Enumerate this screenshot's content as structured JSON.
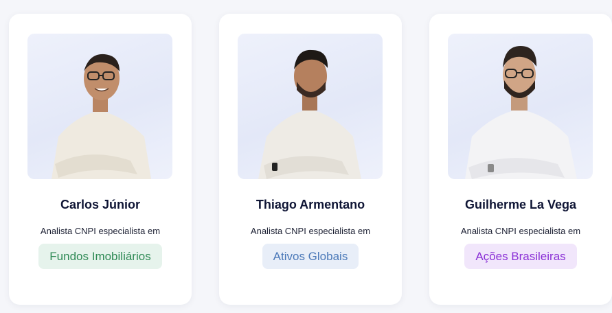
{
  "cards": [
    {
      "name": "Carlos Júnior",
      "role": "Analista CNPI especialista em",
      "tag": "Fundos Imobiliários",
      "tag_bg": "#e6f3ec",
      "tag_color": "#2f8a55"
    },
    {
      "name": "Thiago Armentano",
      "role": "Analista CNPI especialista em",
      "tag": "Ativos Globais",
      "tag_bg": "#e8eef8",
      "tag_color": "#4a78b8"
    },
    {
      "name": "Guilherme La Vega",
      "role": "Analista CNPI especialista em",
      "tag": "Ações Brasileiras",
      "tag_bg": "#f1e6fb",
      "tag_color": "#8a2fd6"
    }
  ]
}
